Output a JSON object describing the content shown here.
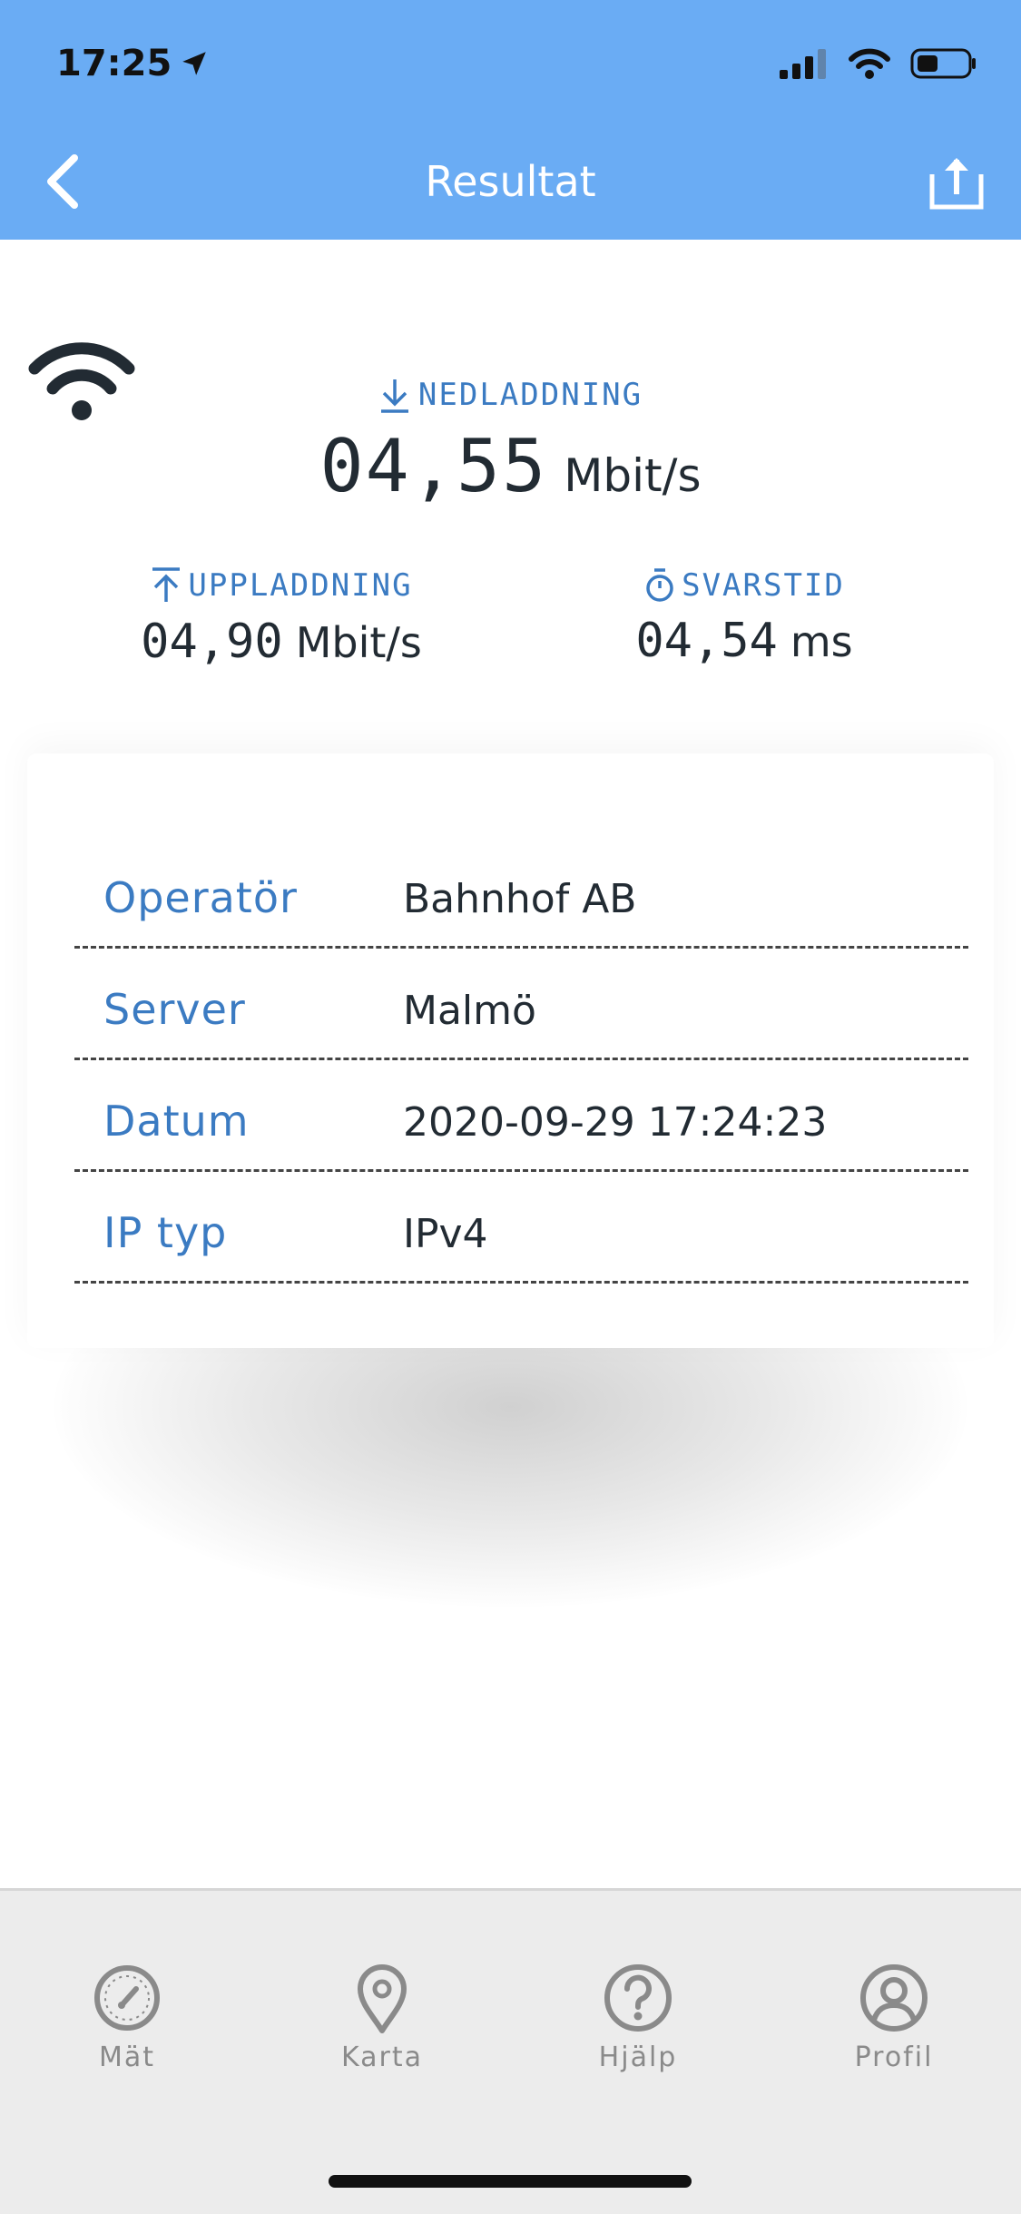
{
  "status_bar": {
    "time": "17:25"
  },
  "header": {
    "title": "Resultat"
  },
  "results": {
    "download": {
      "label": "NEDLADDNING",
      "value": "04,55",
      "unit": "Mbit/s"
    },
    "upload": {
      "label": "UPPLADDNING",
      "value": "04,90",
      "unit": "Mbit/s"
    },
    "latency": {
      "label": "SVARSTID",
      "value": "04,54",
      "unit": "ms"
    }
  },
  "details": [
    {
      "key": "Operatör",
      "value": "Bahnhof AB"
    },
    {
      "key": "Server",
      "value": "Malmö"
    },
    {
      "key": "Datum",
      "value": "2020-09-29 17:24:23"
    },
    {
      "key": "IP typ",
      "value": "IPv4"
    }
  ],
  "tabbar": {
    "items": [
      {
        "label": "Mät",
        "icon": "speedometer-icon"
      },
      {
        "label": "Karta",
        "icon": "map-pin-icon"
      },
      {
        "label": "Hjälp",
        "icon": "help-icon"
      },
      {
        "label": "Profil",
        "icon": "profile-icon"
      }
    ]
  },
  "colors": {
    "header_bg": "#6aacf4",
    "accent_blue": "#3b7bc2",
    "text_dark": "#222b33",
    "tab_gray": "#8a8a8a"
  }
}
